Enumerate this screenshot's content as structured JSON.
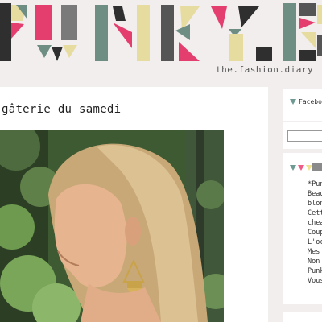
{
  "header": {
    "logo_text": "PUNKY.B",
    "tagline": "the.fashion.diary",
    "colors": [
      "#e9e0a0",
      "#e33e6e",
      "#6e8e84",
      "#2e2e2e"
    ]
  },
  "post": {
    "title": "gâterie du samedi",
    "photo_description_icon": "photo-icon"
  },
  "sidebar": {
    "facebook_label": "Facebook",
    "search_placeholder": "",
    "blog_items": [
      "*Pun",
      "Beau",
      "blon",
      "Cett",
      "chea",
      "Coup",
      "L'oc",
      "Mes",
      "Non",
      "Punk",
      "Vous"
    ]
  }
}
